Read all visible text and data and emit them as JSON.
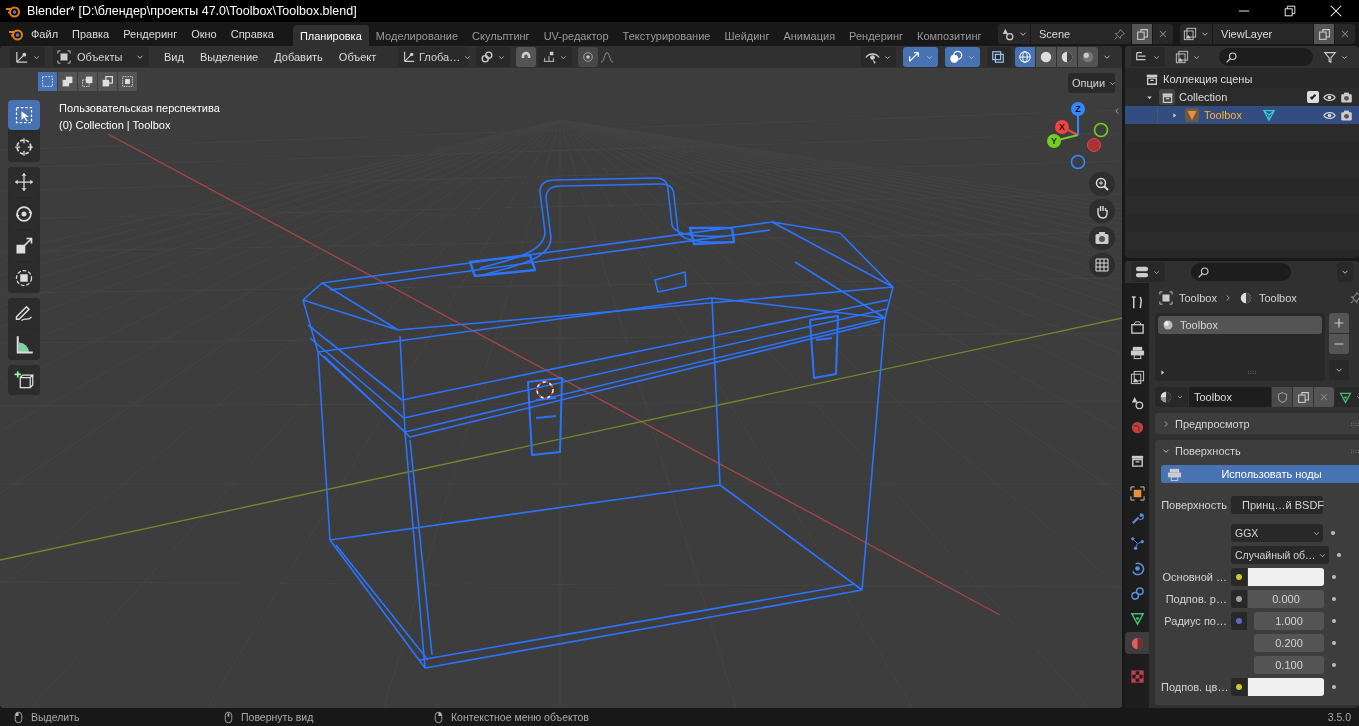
{
  "window": {
    "title": "Blender* [D:\\блендер\\проекты 47.0\\Toolbox\\Toolbox.blend]"
  },
  "menu": [
    "Файл",
    "Правка",
    "Рендеринг",
    "Окно",
    "Справка"
  ],
  "workspaces": [
    {
      "label": "Планировка",
      "selected": true
    },
    {
      "label": "Моделирование",
      "selected": false
    },
    {
      "label": "Скульптинг",
      "selected": false
    },
    {
      "label": "UV-редактор",
      "selected": false
    },
    {
      "label": "Текстурирование",
      "selected": false
    },
    {
      "label": "Шейдинг",
      "selected": false
    },
    {
      "label": "Анимация",
      "selected": false
    },
    {
      "label": "Рендеринг",
      "selected": false
    },
    {
      "label": "Композитинг",
      "selected": false
    }
  ],
  "scene": {
    "name": "Scene"
  },
  "view_layer": {
    "name": "ViewLayer"
  },
  "viewport": {
    "mode": "Объекты",
    "menus": [
      "Вид",
      "Выделение",
      "Добавить",
      "Объект"
    ],
    "orientation": "Глоба…",
    "toggles": [
      {
        "kind": "gizmos",
        "on": true
      },
      {
        "kind": "overlays",
        "on": true
      },
      {
        "kind": "xray",
        "on": false
      }
    ],
    "shading": [
      {
        "kind": "wireframe",
        "selected": true
      },
      {
        "kind": "solid",
        "selected": false
      },
      {
        "kind": "material",
        "selected": false
      },
      {
        "kind": "rendered",
        "selected": false
      }
    ],
    "select_modes": [
      {
        "kind": "set",
        "selected": true
      },
      {
        "kind": "extend",
        "selected": false
      },
      {
        "kind": "subtract",
        "selected": false
      },
      {
        "kind": "invert",
        "selected": false
      },
      {
        "kind": "intersect",
        "selected": false
      }
    ],
    "options": "Опции",
    "view_name": "Пользовательская перспектива",
    "context": "(0) Collection | Toolbox",
    "tool_groups": [
      {
        "tools": [
          {
            "kind": "select",
            "selected": true
          },
          {
            "kind": "cursor",
            "selected": false
          }
        ]
      },
      {
        "tools": [
          {
            "kind": "move",
            "selected": false
          },
          {
            "kind": "rotate",
            "selected": false
          },
          {
            "kind": "scale",
            "selected": false
          },
          {
            "kind": "transform",
            "selected": false
          }
        ]
      },
      {
        "tools": [
          {
            "kind": "annotate",
            "selected": false
          },
          {
            "kind": "measure",
            "selected": false
          }
        ]
      },
      {
        "tools": [
          {
            "kind": "add_cube",
            "selected": false
          }
        ]
      }
    ],
    "gizmo_axes": [
      "X",
      "Y",
      "Z"
    ]
  },
  "outliner": {
    "tree": [
      {
        "label": "Коллекция сцены",
        "selected": false,
        "children": [
          {
            "label": "Collection",
            "selected": false,
            "expanded": true,
            "checked": true,
            "children": [
              {
                "label": "Toolbox",
                "selected": true,
                "expanded": false
              }
            ]
          }
        ]
      }
    ]
  },
  "properties": {
    "tabs": [
      {
        "kind": "tool",
        "selected": false
      },
      {
        "kind": "render",
        "selected": false
      },
      {
        "kind": "output",
        "selected": false
      },
      {
        "kind": "view_layer",
        "selected": false
      },
      {
        "kind": "scene",
        "selected": false
      },
      {
        "kind": "world",
        "selected": false
      },
      {
        "kind": "collection",
        "selected": false
      },
      {
        "kind": "object",
        "selected": false
      },
      {
        "kind": "modifiers",
        "selected": false
      },
      {
        "kind": "particles",
        "selected": false
      },
      {
        "kind": "physics",
        "selected": false
      },
      {
        "kind": "constraints",
        "selected": false
      },
      {
        "kind": "data",
        "selected": false
      },
      {
        "kind": "material",
        "selected": true
      },
      {
        "kind": "texture",
        "selected": false
      }
    ],
    "breadcrumb": [
      "Toolbox",
      "Toolbox"
    ],
    "slots": [
      {
        "name": "Toolbox",
        "selected": true
      }
    ],
    "material": "Toolbox",
    "panels": [
      {
        "title": "Предпросмотр",
        "expanded": false
      },
      {
        "title": "Поверхность",
        "expanded": true,
        "use_nodes": "Использовать ноды",
        "fields": [
          {
            "kind": "socket",
            "label": "Поверхность",
            "value": "Принц…й BSDF"
          },
          {
            "kind": "dropdown",
            "value": "GGX"
          },
          {
            "kind": "dropdown",
            "value": "Случайный об…"
          },
          {
            "kind": "color",
            "label": "Основной …",
            "color": "#f0f0f0"
          },
          {
            "kind": "number",
            "label": "Подпов. р…",
            "value": "0.000"
          },
          {
            "kind": "vector",
            "label": "Радиус по…",
            "values": [
              "1.000",
              "0.200",
              "0.100"
            ]
          },
          {
            "kind": "color",
            "label": "Подпов. цв…",
            "color": "#f0f0f0"
          }
        ]
      }
    ]
  },
  "status_bar": {
    "hints": [
      {
        "kind": "left",
        "label": "Выделить"
      },
      {
        "kind": "middle",
        "label": "Повернуть вид"
      },
      {
        "kind": "right",
        "label": "Контекстное меню объектов"
      }
    ],
    "version": "3.5.0"
  }
}
